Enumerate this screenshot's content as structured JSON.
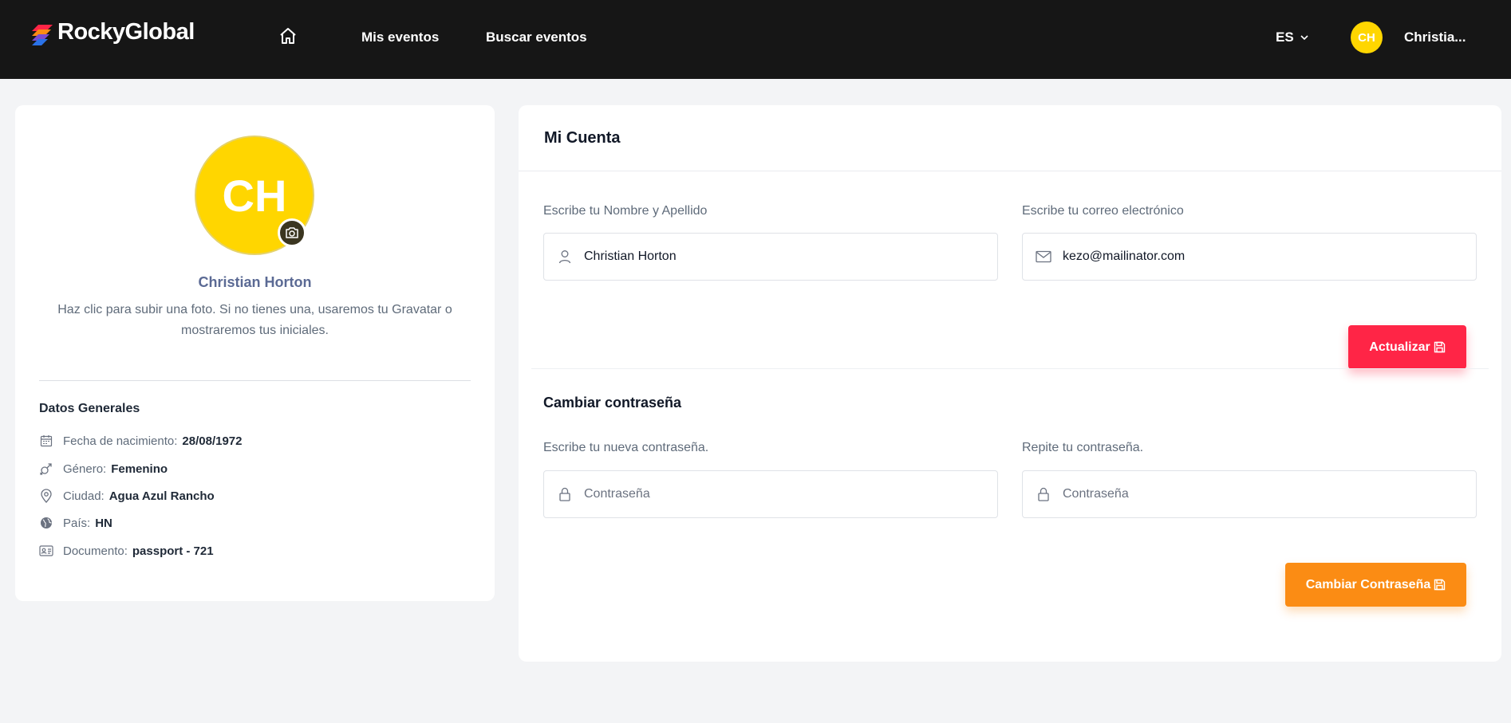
{
  "header": {
    "logo_text": "RockyGlobal",
    "nav": [
      {
        "label": "Mis eventos"
      },
      {
        "label": "Buscar eventos"
      }
    ],
    "language": "ES",
    "avatar_initials": "CH",
    "user_name": "Christia..."
  },
  "profile": {
    "initials": "CH",
    "name": "Christian Horton",
    "upload_hint": "Haz clic para subir una foto. Si no tienes una, usaremos tu Gravatar o mostraremos tus iniciales.",
    "general_title": "Datos Generales",
    "details": [
      {
        "icon": "calendar-icon",
        "label": "Fecha de nacimiento:",
        "value": "28/08/1972"
      },
      {
        "icon": "gender-icon",
        "label": "Género:",
        "value": "Femenino"
      },
      {
        "icon": "location-pin-icon",
        "label": "Ciudad:",
        "value": "Agua Azul Rancho"
      },
      {
        "icon": "globe-icon",
        "label": "País:",
        "value": "HN"
      },
      {
        "icon": "id-card-icon",
        "label": "Documento:",
        "value": "passport - 721"
      }
    ]
  },
  "account": {
    "title": "Mi Cuenta",
    "name_label": "Escribe tu Nombre y Apellido",
    "name_value": "Christian Horton",
    "email_label": "Escribe tu correo electrónico",
    "email_value": "kezo@mailinator.com",
    "update_button": "Actualizar",
    "password_title": "Cambiar contraseña",
    "new_password_label": "Escribe tu nueva contraseña.",
    "new_password_placeholder": "Contraseña",
    "repeat_password_label": "Repite tu contraseña.",
    "repeat_password_placeholder": "Contraseña",
    "change_password_button": "Cambiar Contraseña"
  },
  "colors": {
    "header_bg": "#161616",
    "avatar_yellow": "#ffd600",
    "update_red": "#ff2546",
    "change_orange": "#fb8c14",
    "name_blue": "#5b6a94"
  }
}
